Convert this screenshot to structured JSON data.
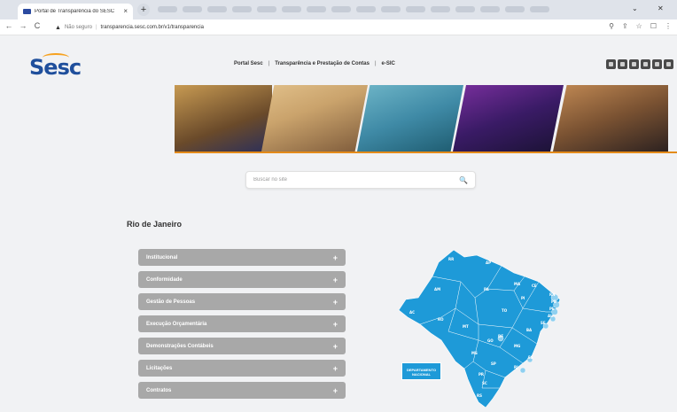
{
  "browser": {
    "tab_title": "Portal de Transparência do SESC",
    "tab_close": "×",
    "new_tab": "+",
    "window_minimize": "⌄",
    "window_close": "✕",
    "nav": {
      "back": "←",
      "forward": "→",
      "reload": "C"
    },
    "omnibox": {
      "warning_icon": "▲",
      "not_secure": "Não seguro",
      "separator": "|",
      "url": "transparencia.sesc.com.br/v1/transparencia"
    },
    "toolbar_icons": [
      "⚲",
      "⇪",
      "☆",
      "☐",
      "⋮"
    ]
  },
  "site": {
    "logo": "Sesc",
    "nav": {
      "items": [
        "Portal Sesc",
        "Transparência e Prestação de Contas",
        "e-SIC"
      ],
      "separator": "|"
    },
    "social_icons": [
      "facebook-icon",
      "youtube-icon",
      "twitter-icon",
      "instagram-icon",
      "linkedin-icon",
      "flickr-icon"
    ]
  },
  "search": {
    "placeholder": "Buscar no site",
    "icon": "🔍"
  },
  "section": {
    "title": "Rio de Janeiro"
  },
  "accordion": [
    {
      "label": "Institucional",
      "icon": "+"
    },
    {
      "label": "Conformidade",
      "icon": "+"
    },
    {
      "label": "Gestão de Pessoas",
      "icon": "+"
    },
    {
      "label": "Execução Orçamentária",
      "icon": "+"
    },
    {
      "label": "Demonstrações Contábeis",
      "icon": "+"
    },
    {
      "label": "Licitações",
      "icon": "+"
    },
    {
      "label": "Contratos",
      "icon": "+"
    }
  ],
  "map": {
    "states": [
      "RR",
      "AP",
      "AM",
      "PA",
      "MA",
      "CE",
      "RN",
      "PB",
      "PE",
      "AL",
      "SE",
      "PI",
      "TO",
      "BA",
      "AC",
      "RO",
      "MT",
      "GO",
      "DF",
      "MG",
      "ES",
      "MS",
      "SP",
      "RJ",
      "PR",
      "SC",
      "RS"
    ],
    "national_label": "DEPARTAMENTO NACIONAL",
    "colors": {
      "state_fill": "#1e9ad8",
      "state_border": "#ffffff"
    }
  },
  "colors": {
    "brand_blue": "#1f4f9c",
    "brand_orange": "#e48b1a",
    "accordion_bg": "#a8a8a8",
    "page_bg": "#f1f2f4"
  }
}
